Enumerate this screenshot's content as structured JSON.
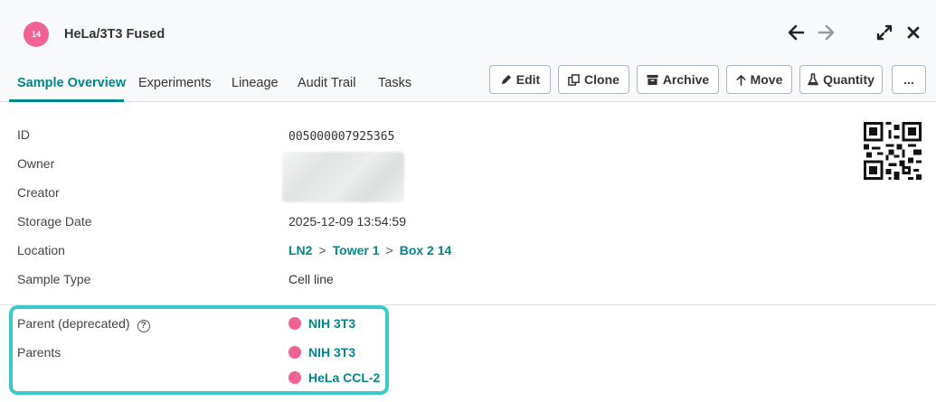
{
  "header": {
    "badge": "14",
    "title": "HeLa/3T3 Fused",
    "icons": [
      "arrow-left-icon",
      "arrow-right-icon",
      "expand-icon",
      "close-icon"
    ]
  },
  "tabs": [
    "Sample Overview",
    "Experiments",
    "Lineage",
    "Audit Trail",
    "Tasks"
  ],
  "toolbar": {
    "edit": "Edit",
    "clone": "Clone",
    "archive": "Archive",
    "move": "Move",
    "quantity": "Quantity",
    "more": "..."
  },
  "details": {
    "id_label": "ID",
    "id_value": "005000007925365",
    "owner_label": "Owner",
    "creator_label": "Creator",
    "storage_date_label": "Storage Date",
    "storage_date_value": "2025-12-09 13:54:59",
    "location_label": "Location",
    "location": [
      "LN2",
      "Tower 1",
      "Box 2 14"
    ],
    "location_sep": ">",
    "sample_type_label": "Sample Type",
    "sample_type_value": "Cell line"
  },
  "lineage": {
    "parent_deprecated_label": "Parent (deprecated)",
    "parent_deprecated_value": "NIH 3T3",
    "parents_label": "Parents",
    "parents": [
      "NIH 3T3",
      "HeLa CCL-2"
    ]
  },
  "colors": {
    "accent": "#00868b",
    "badge": "#f06292",
    "highlight": "#3cc9c9"
  }
}
